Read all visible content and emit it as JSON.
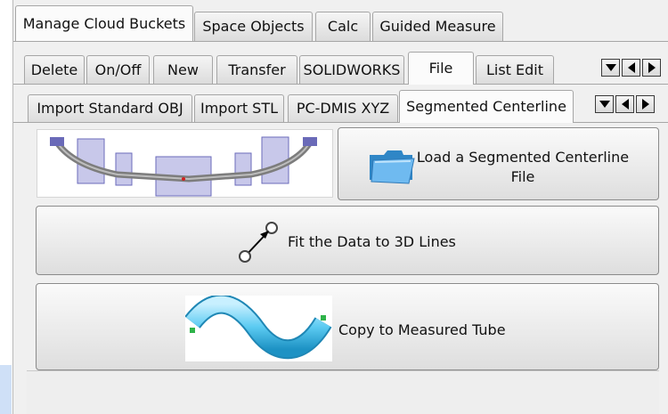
{
  "main_tabs": [
    {
      "label": "Manage Cloud Buckets",
      "active": true
    },
    {
      "label": "Space Objects",
      "active": false
    },
    {
      "label": "Calc",
      "active": false
    },
    {
      "label": "Guided Measure",
      "active": false
    }
  ],
  "sub_tabs": [
    {
      "label": "Delete",
      "active": false
    },
    {
      "label": "On/Off",
      "active": false
    },
    {
      "label": "New",
      "active": false
    },
    {
      "label": "Transfer",
      "active": false
    },
    {
      "label": "SOLIDWORKS",
      "active": false
    },
    {
      "label": "File",
      "active": true
    },
    {
      "label": "List Edit",
      "active": false
    }
  ],
  "file_tabs": [
    {
      "label": "Import Standard OBJ",
      "active": false
    },
    {
      "label": "Import STL",
      "active": false
    },
    {
      "label": "PC-DMIS XYZ",
      "active": false
    },
    {
      "label": "Segmented Centerline",
      "active": true
    }
  ],
  "buttons": {
    "load": "Load a Segmented Centerline File",
    "fit": "Fit the Data to 3D Lines",
    "copy": "Copy to Measured Tube"
  },
  "icons": {
    "nav_down": "chevron-down-icon",
    "nav_left": "chevron-left-icon",
    "nav_right": "chevron-right-icon",
    "folder": "folder-icon",
    "fit_line": "line-fit-icon",
    "tube": "tube-icon"
  }
}
